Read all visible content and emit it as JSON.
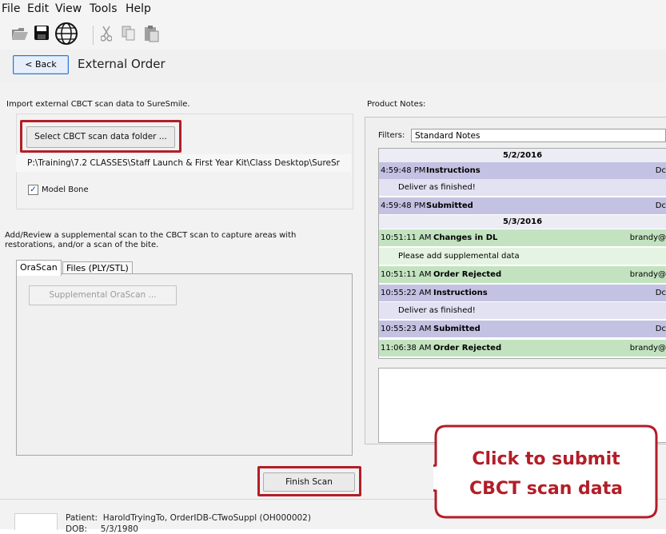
{
  "menu": [
    "File",
    "Edit",
    "View",
    "Tools",
    "Help"
  ],
  "toolbar": {
    "icons": [
      "open-folder-icon",
      "save-icon",
      "globe-icon",
      "cut-icon",
      "copy-icon",
      "paste-icon"
    ]
  },
  "nav": {
    "back_label": "< Back",
    "title": "External Order"
  },
  "import": {
    "description": "Import external CBCT scan data to SureSmile.",
    "select_button": "Select CBCT scan data folder ...",
    "folder_path": "P:\\Training\\7.2 CLASSES\\Staff Launch & First Year Kit\\Class Desktop\\SureSr",
    "model_bone_label": "Model Bone",
    "model_bone_checked": true
  },
  "supplemental": {
    "description_line1": "Add/Review a supplemental scan to the CBCT scan to capture areas with",
    "description_line2": "restorations, and/or a scan of the bite.",
    "tabs": [
      "OraScan",
      "Files (PLY/STL)"
    ],
    "active_tab": "OraScan",
    "button": "Supplemental OraScan ..."
  },
  "finish_button": "Finish Scan",
  "notes": {
    "header": "Product Notes:",
    "filters_label": "Filters:",
    "filter_value": "Standard Notes",
    "entries": [
      {
        "kind": "date",
        "text": "5/2/2016"
      },
      {
        "kind": "head",
        "color": "purple",
        "time": "4:59:48 PM",
        "title": "Instructions",
        "by": "Dc"
      },
      {
        "kind": "body",
        "color": "purple",
        "text": "Deliver as finished!"
      },
      {
        "kind": "head",
        "color": "purple",
        "time": "4:59:48 PM",
        "title": "Submitted",
        "by": "Dc"
      },
      {
        "kind": "date",
        "text": "5/3/2016"
      },
      {
        "kind": "head",
        "color": "green",
        "time": "10:51:11 AM",
        "title": "Changes in DL",
        "by": "brandy@"
      },
      {
        "kind": "body",
        "color": "green",
        "text": "Please add supplemental data"
      },
      {
        "kind": "head",
        "color": "green",
        "time": "10:51:11 AM",
        "title": "Order Rejected",
        "by": "brandy@"
      },
      {
        "kind": "head",
        "color": "purple",
        "time": "10:55:22 AM",
        "title": "Instructions",
        "by": "Dc"
      },
      {
        "kind": "body",
        "color": "purple",
        "text": "Deliver as finished!"
      },
      {
        "kind": "head",
        "color": "purple",
        "time": "10:55:23 AM",
        "title": "Submitted",
        "by": "Dc"
      },
      {
        "kind": "head",
        "color": "green",
        "time": "11:06:38 AM",
        "title": "Order Rejected",
        "by": "brandy@"
      }
    ]
  },
  "patient": {
    "patient_label": "Patient:",
    "patient_value": "HaroldTryingTo, OrderIDB-CTwoSuppl (OH000002)",
    "dob_label": "DOB:",
    "dob_value": "5/3/1980"
  },
  "callout": {
    "line1": "Click to submit",
    "line2": "CBCT scan data",
    "color": "#b21e28"
  }
}
